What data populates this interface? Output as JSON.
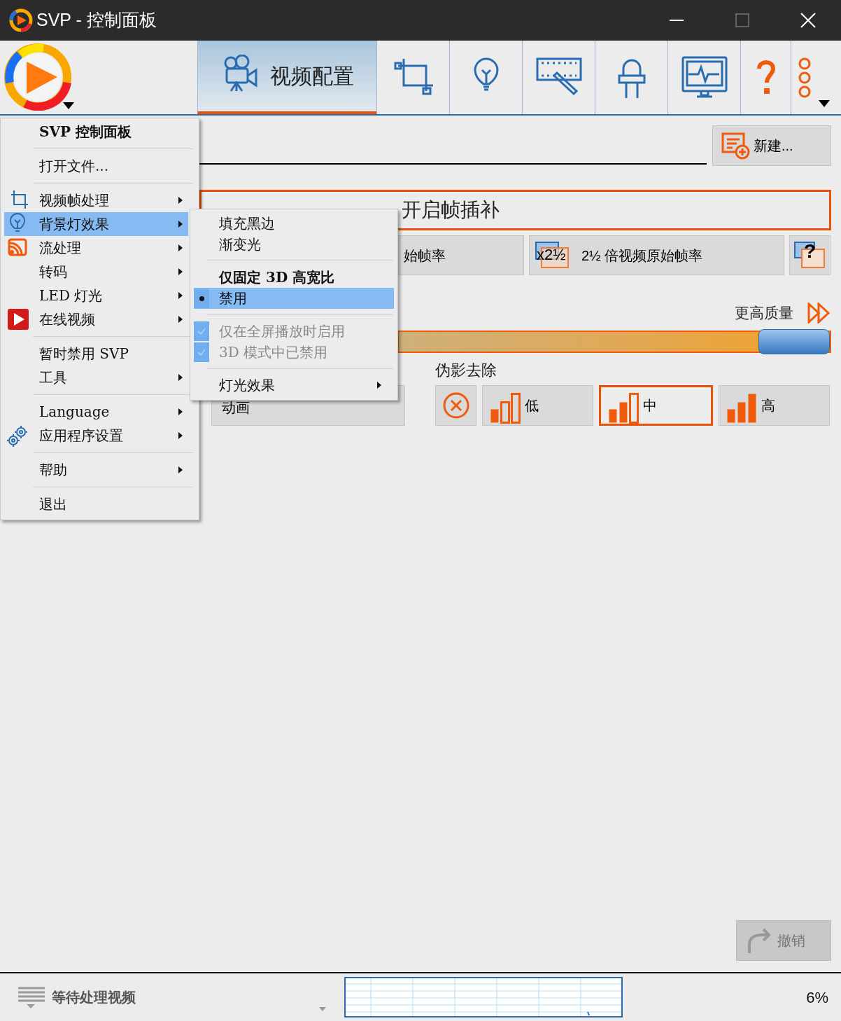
{
  "window": {
    "title": "SVP - 控制面板"
  },
  "toolbar": {
    "tabs": [
      {
        "label": "视频配置",
        "selected": true
      },
      {
        "selected": false
      },
      {
        "selected": false
      },
      {
        "selected": false
      },
      {
        "selected": false
      },
      {
        "selected": false
      },
      {
        "selected": false
      },
      {
        "selected": false
      }
    ]
  },
  "profile": {
    "new_button": "新建..."
  },
  "interpolation": {
    "label": "开启帧插补"
  },
  "framerate_buttons": [
    {
      "label": "始帧率",
      "kind": "text"
    },
    {
      "label": "2½ 倍视频原始帧率",
      "badge": "x2½",
      "kind": "multiplier"
    },
    {
      "label": "?",
      "kind": "help"
    }
  ],
  "quality": {
    "label": "更高质量",
    "level": 1
  },
  "artifacts": {
    "label": "伪影去除",
    "animation_button": "动画",
    "options": [
      {
        "label": "低",
        "selected": false
      },
      {
        "label": "中",
        "selected": true
      },
      {
        "label": "高",
        "selected": false
      }
    ]
  },
  "undo_button": {
    "label": "撤销",
    "disabled": true
  },
  "status_bar": {
    "text": "等待处理视频",
    "percent": "6%"
  },
  "main_menu": {
    "groups": [
      [
        {
          "label": "SVP 控制面板",
          "kind": "title",
          "submenu": false,
          "selected": false
        }
      ],
      [
        {
          "label": "打开文件...",
          "kind": "item",
          "submenu": false,
          "selected": false
        }
      ],
      [
        {
          "label": "视频帧处理",
          "kind": "item",
          "submenu": true,
          "selected": false
        },
        {
          "label": "背景灯效果",
          "kind": "item",
          "submenu": true,
          "selected": true
        },
        {
          "label": "流处理",
          "kind": "item",
          "submenu": true,
          "selected": false
        },
        {
          "label": "转码",
          "kind": "item",
          "submenu": true,
          "selected": false
        },
        {
          "label": "LED 灯光",
          "kind": "item",
          "submenu": true,
          "selected": false
        },
        {
          "label": "在线视频",
          "kind": "item",
          "submenu": true,
          "selected": false
        }
      ],
      [
        {
          "label": "暂时禁用 SVP",
          "kind": "item",
          "submenu": false,
          "selected": false
        },
        {
          "label": "工具",
          "kind": "item",
          "submenu": true,
          "selected": false
        }
      ],
      [
        {
          "label": "Language",
          "kind": "item",
          "submenu": true,
          "selected": false
        },
        {
          "label": "应用程序设置",
          "kind": "item",
          "submenu": true,
          "selected": false
        }
      ],
      [
        {
          "label": "帮助",
          "kind": "item",
          "submenu": true,
          "selected": false
        }
      ],
      [
        {
          "label": "退出",
          "kind": "item",
          "submenu": false,
          "selected": false
        }
      ]
    ]
  },
  "submenu": {
    "groups": [
      [
        {
          "label": "填充黑边",
          "kind": "item",
          "submenu": false,
          "selected": false
        },
        {
          "label": "渐变光",
          "kind": "item",
          "submenu": false,
          "selected": false
        }
      ],
      [
        {
          "label": "仅固定 3D 高宽比",
          "kind": "title",
          "submenu": false,
          "selected": false
        },
        {
          "label": "禁用",
          "kind": "radio",
          "checked": true,
          "submenu": false,
          "selected": true
        }
      ],
      [
        {
          "label": "仅在全屏播放时启用",
          "kind": "check",
          "checked": true,
          "disabled": true,
          "submenu": false,
          "selected": false
        },
        {
          "label": "3D 模式中已禁用",
          "kind": "check",
          "checked": true,
          "disabled": true,
          "submenu": false,
          "selected": false
        }
      ],
      [
        {
          "label": "灯光效果",
          "kind": "item",
          "submenu": true,
          "selected": false
        }
      ]
    ]
  }
}
